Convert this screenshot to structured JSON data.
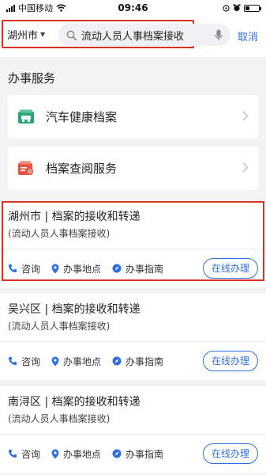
{
  "status": {
    "carrier": "中国移动",
    "time": "09:46"
  },
  "header": {
    "city": "湖州市",
    "query": "流动人员人事档案接收",
    "cancel_label": "取消"
  },
  "section": {
    "title": "办事服务",
    "services": [
      {
        "label": "汽车健康档案",
        "icon": "car-file-icon"
      },
      {
        "label": "档案查阅服务",
        "icon": "file-search-icon"
      }
    ]
  },
  "results": [
    {
      "title": "湖州市 | 档案的接收和转递",
      "subtitle": "(流动人员人事档案接收)",
      "consult": "咨询",
      "location": "办事地点",
      "guide": "办事指南",
      "online": "在线办理"
    },
    {
      "title": "吴兴区 | 档案的接收和转递",
      "subtitle": "(流动人员人事档案接收)",
      "consult": "咨询",
      "location": "办事地点",
      "guide": "办事指南",
      "online": "在线办理"
    },
    {
      "title": "南浔区 | 档案的接收和转递",
      "subtitle": "(流动人员人事档案接收)",
      "consult": "咨询",
      "location": "办事地点",
      "guide": "办事指南",
      "online": "在线办理"
    }
  ],
  "colors": {
    "accent": "#2f6fe0",
    "highlight": "#d9321f",
    "service_green": "#2aa776",
    "service_red": "#e2543f"
  }
}
